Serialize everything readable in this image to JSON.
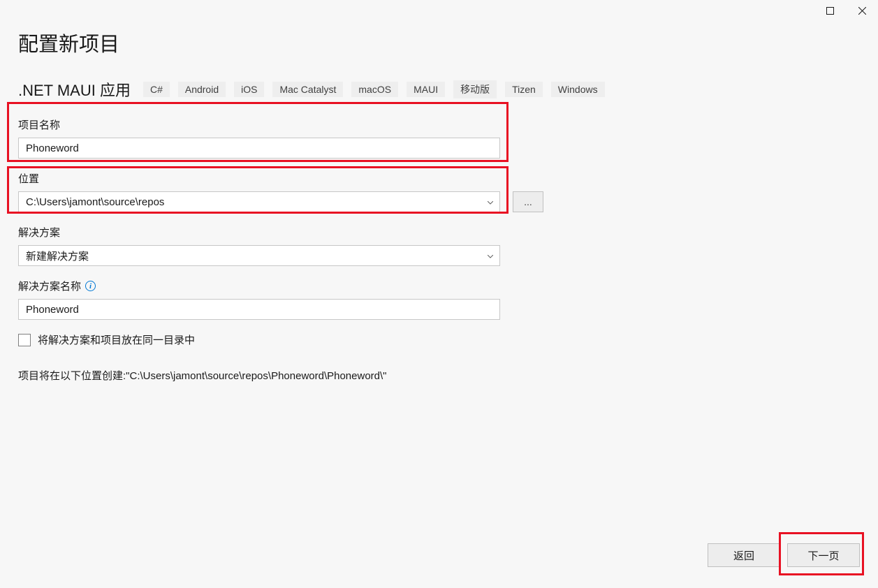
{
  "titlebar": {
    "maximize": "maximize",
    "close": "close"
  },
  "header": {
    "title": "配置新项目",
    "template_name": ".NET MAUI 应用",
    "tags": [
      "C#",
      "Android",
      "iOS",
      "Mac Catalyst",
      "macOS",
      "MAUI",
      "移动版",
      "Tizen",
      "Windows"
    ]
  },
  "fields": {
    "project_name": {
      "label": "项目名称",
      "value": "Phoneword"
    },
    "location": {
      "label": "位置",
      "value": "C:\\Users\\jamont\\source\\repos",
      "browse_label": "..."
    },
    "solution": {
      "label": "解决方案",
      "value": "新建解决方案"
    },
    "solution_name": {
      "label": "解决方案名称",
      "value": "Phoneword"
    },
    "same_dir": {
      "label": "将解决方案和项目放在同一目录中",
      "checked": false
    }
  },
  "path_info": "项目将在以下位置创建:\"C:\\Users\\jamont\\source\\repos\\Phoneword\\Phoneword\\\"",
  "footer": {
    "back": "返回",
    "next": "下一页"
  }
}
